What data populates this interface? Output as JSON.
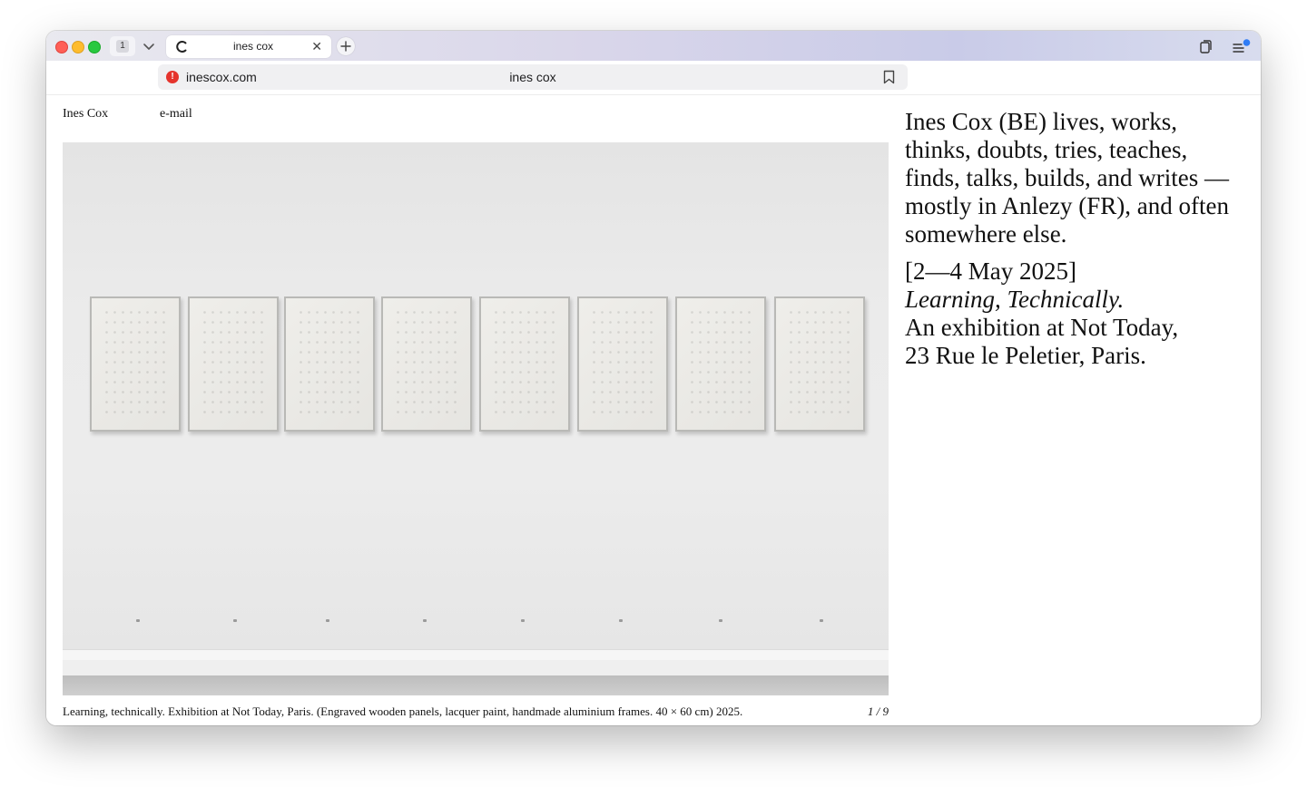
{
  "browser": {
    "tab_count": "1",
    "tab": {
      "title": "ines cox"
    },
    "address": {
      "domain": "inescox.com",
      "page_title": "ines cox"
    }
  },
  "site": {
    "nav": {
      "name": "Ines Cox",
      "email": "e-mail"
    },
    "slideshow": {
      "caption": "Learning, technically. Exhibition at Not Today, Paris. (Engraved wooden panels, lacquer paint, handmade aluminium frames. 40 × 60 cm) 2025.",
      "counter": "1 / 9",
      "panel_count": 8
    },
    "bio": {
      "intro": "Ines Cox (BE) lives, works, thinks, doubts, tries, teaches, finds, talks, builds, and writes — mostly in Anlezy (FR), and often somewhere else.",
      "dates": "[2—4 May 2025]",
      "exhibition_title": "Learning, Technically.",
      "line_1": "An exhibition at Not Today,",
      "line_2": "23 Rue le Peletier, Paris."
    }
  },
  "colors": {
    "close": "#ff5f57",
    "minimize": "#febc2e",
    "zoom": "#28c840",
    "warning": "#e5342d"
  }
}
